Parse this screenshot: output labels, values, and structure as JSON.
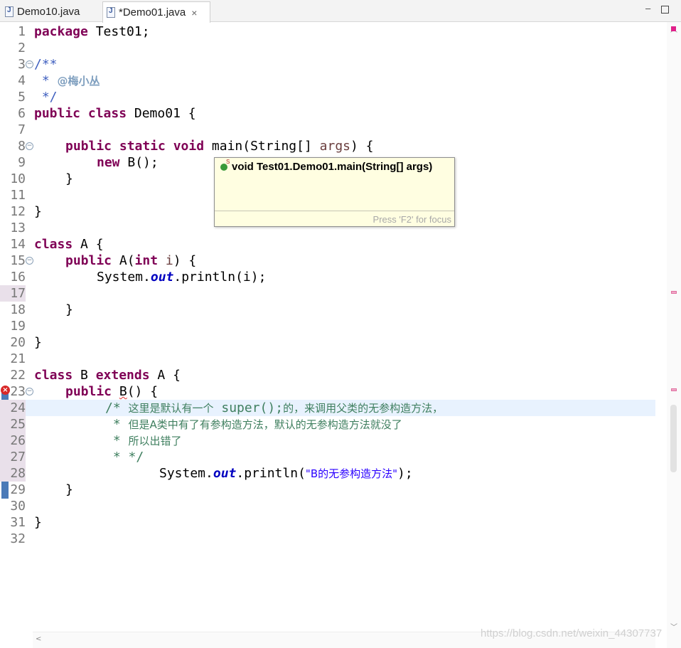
{
  "tabs": [
    {
      "label": "Demo10.java",
      "active": false
    },
    {
      "label": "*Demo01.java",
      "active": true,
      "close": "×"
    }
  ],
  "window_buttons": {
    "minimize": "–",
    "maximize": "□"
  },
  "code_lines": [
    {
      "n": "1"
    },
    {
      "n": "2"
    },
    {
      "n": "3"
    },
    {
      "n": "4"
    },
    {
      "n": "5"
    },
    {
      "n": "6"
    },
    {
      "n": "7"
    },
    {
      "n": "8"
    },
    {
      "n": "9"
    },
    {
      "n": "10"
    },
    {
      "n": "11"
    },
    {
      "n": "12"
    },
    {
      "n": "13"
    },
    {
      "n": "14"
    },
    {
      "n": "15"
    },
    {
      "n": "16"
    },
    {
      "n": "17"
    },
    {
      "n": "18"
    },
    {
      "n": "19"
    },
    {
      "n": "20"
    },
    {
      "n": "21"
    },
    {
      "n": "22"
    },
    {
      "n": "23"
    },
    {
      "n": "24"
    },
    {
      "n": "25"
    },
    {
      "n": "26"
    },
    {
      "n": "27"
    },
    {
      "n": "28"
    },
    {
      "n": "29"
    },
    {
      "n": "30"
    },
    {
      "n": "31"
    },
    {
      "n": "32"
    }
  ],
  "code": {
    "l1_kw": "package",
    "l1_rest": " Test01;",
    "l3": "/**",
    "l4_star": " * ",
    "l4_tag": "@梅小丛",
    "l5": " */",
    "l6_kw": "public class",
    "l6_rest": " Demo01 {",
    "l8_kw": "public static void",
    "l8_rest": " main(String[] ",
    "l8_param": "args",
    "l8_end": ") {",
    "l9_kw": "new",
    "l9_rest": " B();",
    "l10": "}",
    "l12": "}",
    "l14_kw": "class",
    "l14_rest": " A {",
    "l15_kw1": "public",
    "l15_mid": " A(",
    "l15_kw2": "int",
    "l15_param": " i",
    "l15_end": ") {",
    "l16_a": "System.",
    "l16_fld": "out",
    "l16_b": ".println(i);",
    "l18": "}",
    "l20": "}",
    "l22_kw1": "class",
    "l22_mid": " B ",
    "l22_kw2": "extends",
    "l22_end": " A {",
    "l23_kw": "public",
    "l23_sp": " ",
    "l23_err": "B",
    "l23_end": "() {",
    "l24_a": "/* ",
    "l24_b": "这里是默认有一个",
    "l24_c": " super();",
    "l24_d": "的，来调用父类的无参构造方法，",
    "l25_a": " * ",
    "l25_b": "但是A类中有了有参构造方法，默认的无参构造方法就没了",
    "l26_a": " * ",
    "l26_b": "所以出错了",
    "l27": " * */",
    "l28_a": "System.",
    "l28_fld": "out",
    "l28_b": ".println(",
    "l28_str": "\"B的无参构造方法\"",
    "l28_c": ");",
    "l29": "}",
    "l31": "}"
  },
  "tooltip": {
    "signature": "void Test01.Demo01.main(String[] args)",
    "footer": "Press 'F2' for focus"
  },
  "watermark": "https://blog.csdn.net/weixin_44307737",
  "colors": {
    "keyword": "#7f0055",
    "comment": "#3f7f5f",
    "javadoc": "#3f5fbf",
    "string": "#2a00ff",
    "field": "#0000c0"
  }
}
